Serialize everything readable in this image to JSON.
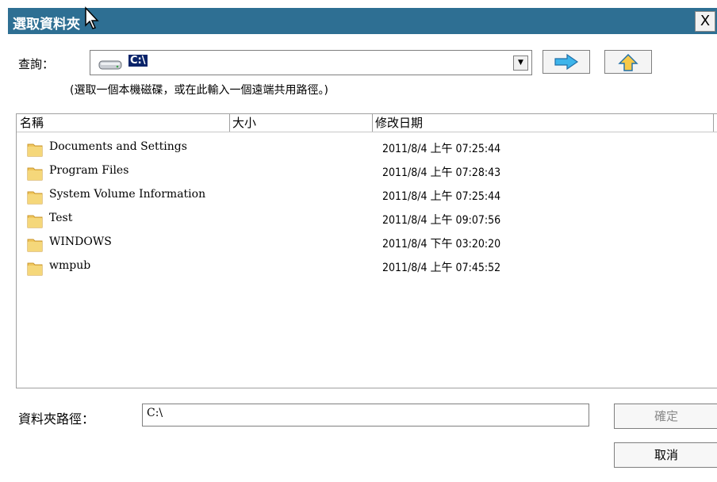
{
  "window": {
    "title": "選取資料夾",
    "close_label": "X"
  },
  "lookin": {
    "label": "查詢：",
    "drive_icon": "hard-drive-icon",
    "value": "C:\\"
  },
  "nav": {
    "go_icon": "right-arrow-icon",
    "up_icon": "up-arrow-icon"
  },
  "hint": "(選取一個本機磁碟，或在此輸入一個遠端共用路徑。)",
  "columns": [
    "名稱",
    "大小",
    "修改日期"
  ],
  "files": [
    {
      "name": "Documents and Settings",
      "size": "",
      "modified": "2011/8/4 上午 07:25:44"
    },
    {
      "name": "Program Files",
      "size": "",
      "modified": "2011/8/4 上午 07:28:43"
    },
    {
      "name": "System Volume Information",
      "size": "",
      "modified": "2011/8/4 上午 07:25:44"
    },
    {
      "name": "Test",
      "size": "",
      "modified": "2011/8/4 上午 09:07:56"
    },
    {
      "name": "WINDOWS",
      "size": "",
      "modified": "2011/8/4 下午 03:20:20"
    },
    {
      "name": "wmpub",
      "size": "",
      "modified": "2011/8/4 上午 07:45:52"
    }
  ],
  "path": {
    "label": "資料夾路徑：",
    "value": "C:\\"
  },
  "buttons": {
    "ok": "確定",
    "cancel": "取消"
  },
  "colors": {
    "titlebar": "#2e6f93",
    "folder": "#f0c75e"
  }
}
